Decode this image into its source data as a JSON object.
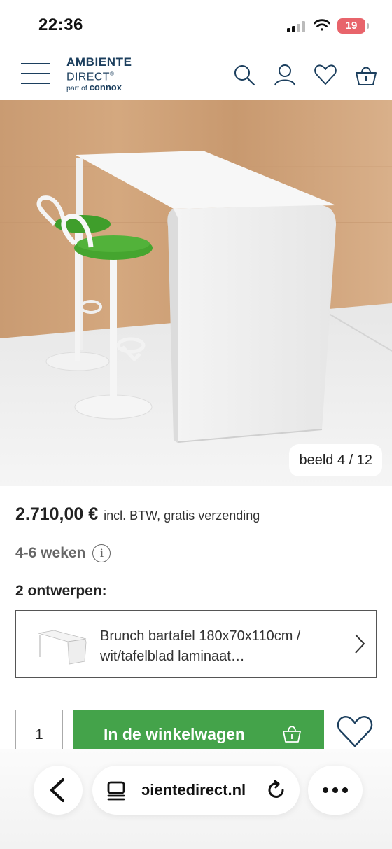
{
  "status": {
    "time": "22:36",
    "battery": "19"
  },
  "header": {
    "logo": {
      "line1": "AMBIENTE",
      "line2": "DIRECT",
      "registered": "®",
      "line3_prefix": "part of",
      "line3_brand": "connox"
    },
    "icons": [
      "menu-icon",
      "search-icon",
      "account-icon",
      "heart-icon",
      "basket-icon"
    ],
    "brand_color": "#1c3f5e"
  },
  "product_image": {
    "counter": "beeld 4 / 12"
  },
  "product": {
    "price": "2.710,00 €",
    "price_note": "incl. BTW, gratis verzending",
    "delivery": "4-6 weken",
    "info_glyph": "i",
    "designs_label": "2 ontwerpen:",
    "variant_text_1": "Brunch bartafel 180x70x110cm /",
    "variant_text_2": "wit/tafelblad laminaat…"
  },
  "cart": {
    "quantity": "1",
    "add_label": "In de winkelwagen",
    "button_color": "#44a34a"
  },
  "browser": {
    "url": "ɔientedirect.nl",
    "icons": [
      "back-icon",
      "reader-icon",
      "reload-icon",
      "more-icon"
    ]
  }
}
